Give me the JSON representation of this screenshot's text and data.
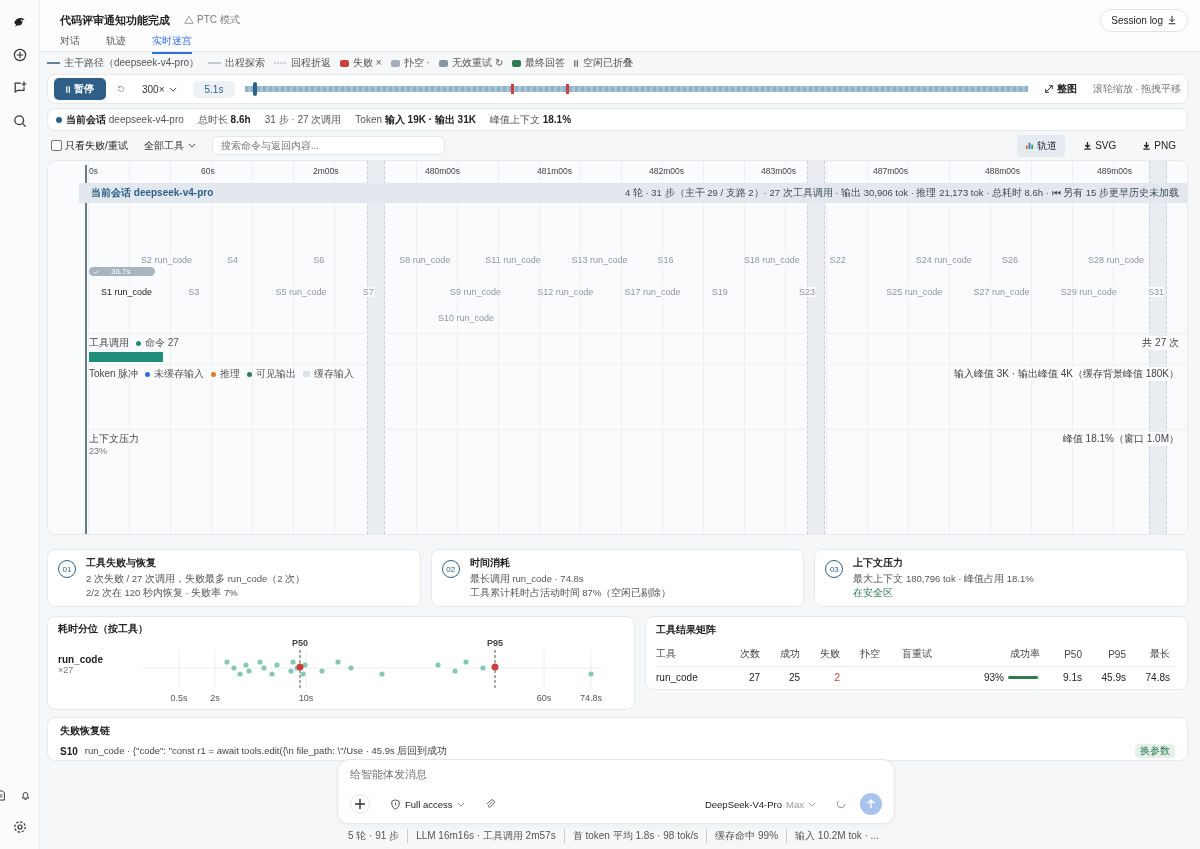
{
  "header": {
    "title": "代码评审通知功能完成",
    "mode": "PTC 模式",
    "session_log": "Session log"
  },
  "tabs": [
    {
      "label": "对话",
      "selected": false
    },
    {
      "label": "轨迹",
      "selected": false
    },
    {
      "label": "实时迷宫",
      "selected": true
    }
  ],
  "legend": [
    {
      "kind": "solid",
      "label": "主干路径（deepseek-v4-pro）"
    },
    {
      "kind": "thin",
      "label": "出程探索"
    },
    {
      "kind": "dashed",
      "label": "回程折返"
    },
    {
      "kind": "square",
      "color": "#c8413b",
      "label": "失败 ×"
    },
    {
      "kind": "square",
      "color": "#a3adb9",
      "label": "扑空 ·"
    },
    {
      "kind": "square",
      "color": "#8593a6",
      "label": "无效重试 ↻"
    },
    {
      "kind": "square",
      "color": "#2f7a52",
      "label": "最终回答"
    },
    {
      "kind": "pause",
      "label": "空闲已折叠"
    }
  ],
  "player": {
    "pause_label": "暂停",
    "speed": "300×",
    "time": "5.1s",
    "level": 0.01,
    "fit_label": "整图",
    "hint": "滚轮缩放 · 拖拽平移"
  },
  "stats": [
    {
      "text": "**当前会话** deepseek-v4-pro",
      "dot": true
    },
    {
      "text": "总时长 **8.6h**",
      "dot": false
    },
    {
      "text": "31 步 · 27 次调用",
      "dot": false
    },
    {
      "text": "Token **输入 19K · 输出 31K**",
      "dot": false
    },
    {
      "text": "峰值上下文 **18.1%**",
      "dot": false
    }
  ],
  "filters": {
    "failed_only": {
      "label": "只看失败/重试",
      "checked": false
    },
    "tool_select": "全部工具",
    "search_placeholder": "搜索命令与返回内容...",
    "views": [
      {
        "kind": "chart",
        "label": "轨道",
        "selected": true
      },
      {
        "kind": "download",
        "label": "SVG",
        "selected": false
      },
      {
        "kind": "download",
        "label": "PNG",
        "selected": false
      }
    ]
  },
  "timeline": {
    "ticks": [
      "0s",
      "60s",
      "2m00s",
      "480m00s",
      "481m00s",
      "482m00s",
      "483m00s",
      "487m00s",
      "488m00s",
      "489m00s"
    ],
    "session": {
      "title": "当前会话 deepseek-v4-pro",
      "summary": "4 轮 · 31 步（主干 29 / 支路 2）· 27 次工具调用 · 输出 30,906 tok · 推理 21,173 tok · 总耗时 8.6h · ⏮ 另有 15 步更早历史未加载"
    },
    "progress": "36.7s",
    "step_rows": [
      {
        "kind": "upper",
        "steps": [
          {
            "label": "S2 run_code",
            "current": false
          },
          {
            "label": "S4",
            "current": false
          },
          {
            "label": "S6",
            "current": false
          },
          {
            "label": "S8 run_code",
            "current": false
          },
          {
            "label": "S11 run_code",
            "current": false
          },
          {
            "label": "S13 run_code",
            "current": false
          },
          {
            "label": "S16",
            "current": false
          },
          {
            "label": "S18 run_code",
            "current": false
          },
          {
            "label": "S22",
            "current": false
          },
          {
            "label": "S24 run_code",
            "current": false
          },
          {
            "label": "S26",
            "current": false
          },
          {
            "label": "S28 run_code",
            "current": false
          }
        ]
      },
      {
        "kind": "lower",
        "steps": [
          {
            "label": "S1 run_code",
            "current": true
          },
          {
            "label": "S3",
            "current": false
          },
          {
            "label": "S5 run_code",
            "current": false
          },
          {
            "label": "S7",
            "current": false
          },
          {
            "label": "S9 run_code",
            "current": false
          },
          {
            "label": "S12 run_code",
            "current": false
          },
          {
            "label": "S17 run_code",
            "current": false
          },
          {
            "label": "S19",
            "current": false
          },
          {
            "label": "S23",
            "current": false
          },
          {
            "label": "S25 run_code",
            "current": false
          },
          {
            "label": "S27 run_code",
            "current": false
          },
          {
            "label": "S29 run_code",
            "current": false
          },
          {
            "label": "S31",
            "current": false
          }
        ]
      },
      {
        "kind": "branch",
        "steps": [
          {
            "label": "S10 run_code",
            "current": false
          }
        ]
      }
    ],
    "lanes": [
      {
        "kind": "tools",
        "title": "工具调用",
        "legend": [
          {
            "label": "命令 27",
            "color": "#1f8f7c"
          }
        ],
        "right": "共 27 次"
      },
      {
        "kind": "token",
        "title": "Token 脉冲",
        "legend": [
          {
            "label": "未缓存输入",
            "color": "#2f6fe0"
          },
          {
            "label": "推理",
            "color": "#e07b1f"
          },
          {
            "label": "可见输出",
            "color": "#2f7a52"
          },
          {
            "label": "缓存输入",
            "color": "#dde3ea"
          }
        ],
        "right": "输入峰值 3K · 输出峰值 4K（缓存背景峰值 180K）"
      },
      {
        "kind": "context",
        "title": "上下文压力",
        "value": "23%",
        "right": "峰值 18.1%（窗口 1.0M）"
      }
    ]
  },
  "cards": [
    {
      "number": "01",
      "title": "工具失败与恢复",
      "lines": [
        {
          "kind": "plain",
          "text": "2 次失败 / 27 次调用，失败最多 run_code（2 次）"
        },
        {
          "kind": "plain",
          "text": "2/2 次在 120 秒内恢复 · 失败率 7%"
        }
      ]
    },
    {
      "number": "02",
      "title": "时间消耗",
      "lines": [
        {
          "kind": "plain",
          "text": "最长调用 run_code · 74.8s"
        },
        {
          "kind": "plain",
          "text": "工具累计耗时占活动时间 87%（空闲已剔除）"
        }
      ]
    },
    {
      "number": "03",
      "title": "上下文压力",
      "lines": [
        {
          "kind": "plain",
          "text": "最大上下文 180,796 tok · 峰值占用 18.1%"
        },
        {
          "kind": "ok",
          "text": "在安全区"
        }
      ]
    }
  ],
  "percentile": {
    "title": "耗时分位（按工具）",
    "tool": "run_code",
    "count": "×27",
    "kind": "picture",
    "axis_labels": [
      "0.5s",
      "2s",
      "10s",
      "60s",
      "74.8s"
    ],
    "markers": [
      "P50",
      "P95"
    ]
  },
  "matrix": {
    "title": "工具结果矩阵",
    "columns": [
      "工具",
      "次数",
      "成功",
      "失败",
      "扑空",
      "盲重试",
      "成功率",
      "P50",
      "P95",
      "最长"
    ],
    "rows": [
      {
        "tool": "run_code",
        "count": "27",
        "success": "25",
        "failed": "2",
        "rate": "93%",
        "level": 0.93,
        "p50": "9.1s",
        "p95": "45.9s",
        "max": "74.8s"
      }
    ]
  },
  "chain": {
    "title": "失败恢复链",
    "items": [
      {
        "step": "S10",
        "text": "run_code · {\"code\": \"const r1 = await tools.edit({\\n file_path: \\\"/Use · 45.9s 后回到成功",
        "tag": "换参数"
      }
    ]
  },
  "composer": {
    "placeholder": "给智能体发消息",
    "access": "Full access",
    "model": "DeepSeek-V4-Pro",
    "effort": "Max"
  },
  "footer": [
    "5 轮 · 91 步",
    "LLM 16m16s · 工具调用 2m57s",
    "首 token 平均 1.8s · 98 tok/s",
    "缓存命中 99%",
    "输入 10.2M tok · ..."
  ]
}
